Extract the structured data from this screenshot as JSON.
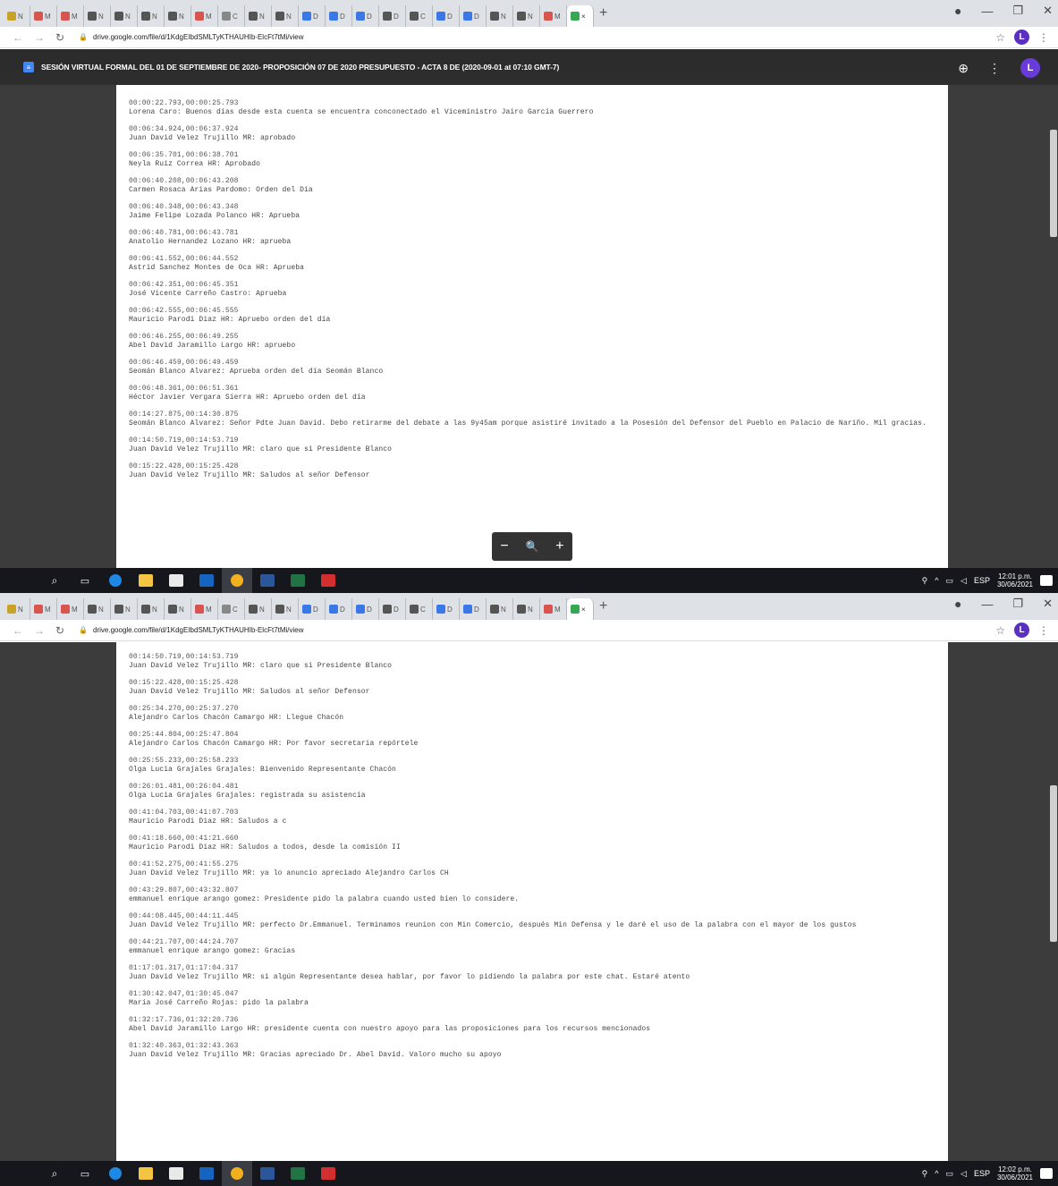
{
  "browser": {
    "url": "drive.google.com/file/d/1KdgEIbdSMLTyKTHAUHIb-ElcFt7tMi/view",
    "tabs": [
      {
        "label": "N",
        "fav": "#c9a227"
      },
      {
        "label": "M",
        "fav": "#d9534f"
      },
      {
        "label": "M",
        "fav": "#d9534f"
      },
      {
        "label": "N",
        "fav": "#555"
      },
      {
        "label": "N",
        "fav": "#555"
      },
      {
        "label": "N",
        "fav": "#555"
      },
      {
        "label": "N",
        "fav": "#555"
      },
      {
        "label": "M",
        "fav": "#d9534f"
      },
      {
        "label": "C",
        "fav": "#888"
      },
      {
        "label": "N",
        "fav": "#555"
      },
      {
        "label": "N",
        "fav": "#555"
      },
      {
        "label": "D",
        "fav": "#3b78e7"
      },
      {
        "label": "D",
        "fav": "#3b78e7"
      },
      {
        "label": "D",
        "fav": "#3b78e7"
      },
      {
        "label": "D",
        "fav": "#555"
      },
      {
        "label": "C",
        "fav": "#555"
      },
      {
        "label": "D",
        "fav": "#3b78e7"
      },
      {
        "label": "D",
        "fav": "#3b78e7"
      },
      {
        "label": "N",
        "fav": "#555"
      },
      {
        "label": "N",
        "fav": "#555"
      },
      {
        "label": "M",
        "fav": "#d9534f"
      },
      {
        "label": "×",
        "fav": "#34a853",
        "active": true
      }
    ]
  },
  "viewer": {
    "title": "SESIÓN VIRTUAL FORMAL DEL 01 DE SEPTIEMBRE DE 2020- PROPOSICIÓN 07 DE 2020 PRESUPUESTO - ACTA 8 DE (2020-09-01 at 07:10 GMT-7)",
    "avatar_letter": "L"
  },
  "transcript_top": [
    {
      "ts": "00:00:22.793,00:00:25.793",
      "txt": "Lorena Caro: Buenos días desde esta cuenta se encuentra conconectado el Viceministro Jairo García Guerrero"
    },
    {
      "ts": "00:06:34.924,00:06:37.924",
      "txt": "Juan David Velez Trujillo MR: aprobado"
    },
    {
      "ts": "00:06:35.701,00:06:38.701",
      "txt": "Neyla Ruiz Correa HR: Aprobado"
    },
    {
      "ts": "00:06:40.208,00:06:43.208",
      "txt": "Carmen Rosaca Arias Pardomo: Orden del Día"
    },
    {
      "ts": "00:06:40.348,00:06:43.348",
      "txt": "Jaime Felipe Lozada Polanco HR: Aprueba"
    },
    {
      "ts": "00:06:40.781,00:06:43.781",
      "txt": "Anatolio Hernandez Lozano HR: aprueba"
    },
    {
      "ts": "00:06:41.552,00:06:44.552",
      "txt": "Astrid Sanchez Montes de Oca HR: Aprueba"
    },
    {
      "ts": "00:06:42.351,00:06:45.351",
      "txt": "José Vicente Carreño Castro: Aprueba"
    },
    {
      "ts": "00:06:42.555,00:06:45.555",
      "txt": "Mauricio Parodi Diaz HR: Apruebo orden del día"
    },
    {
      "ts": "00:06:46.255,00:06:49.255",
      "txt": "Abel David Jaramillo Largo HR: apruebo"
    },
    {
      "ts": "00:06:46.459,00:06:49.459",
      "txt": "Seomán Blanco Alvarez: Aprueba orden del día Seomán Blanco"
    },
    {
      "ts": "00:06:48.361,00:06:51.361",
      "txt": "Héctor Javier Vergara Sierra HR: Apruebo orden del día"
    },
    {
      "ts": "00:14:27.875,00:14:30.875",
      "txt": "Seomán Blanco Alvarez: Señor Pdte Juan David. Debo retirarme del debate a las 9y45am porque asistiré invitado a la Posesión del Defensor del Pueblo en Palacio de Nariño. Mil gracias."
    },
    {
      "ts": "00:14:50.719,00:14:53.719",
      "txt": "Juan David Velez Trujillo MR: claro que si Presidente Blanco"
    },
    {
      "ts": "00:15:22.428,00:15:25.428",
      "txt": "Juan David Velez Trujillo MR: Saludos al señor Defensor"
    }
  ],
  "transcript_bottom": [
    {
      "ts": "00:14:50.719,00:14:53.719",
      "txt": "Juan David Velez Trujillo MR: claro que si Presidente Blanco"
    },
    {
      "ts": "00:15:22.428,00:15:25.428",
      "txt": "Juan David Velez Trujillo MR: Saludos al señor Defensor"
    },
    {
      "ts": "00:25:34.270,00:25:37.270",
      "txt": "Alejandro Carlos Chacón Camargo HR: Llegue Chacón"
    },
    {
      "ts": "00:25:44.804,00:25:47.804",
      "txt": "Alejandro Carlos Chacón Camargo HR: Por favor secretaria repórtele"
    },
    {
      "ts": "00:25:55.233,00:25:58.233",
      "txt": "Olga Lucia Grajales Grajales: Bienvenido Representante Chacón"
    },
    {
      "ts": "00:26:01.481,00:26:04.481",
      "txt": "Olga Lucia Grajales Grajales: registrada su asistencia"
    },
    {
      "ts": "00:41:04.703,00:41:07.703",
      "txt": "Mauricio Parodi Diaz HR: Saludos a c"
    },
    {
      "ts": "00:41:18.660,00:41:21.660",
      "txt": "Mauricio Parodi Diaz HR: Saludos a todos, desde la comisión II"
    },
    {
      "ts": "00:41:52.275,00:41:55.275",
      "txt": "Juan David Velez Trujillo MR: ya lo anuncio apreciado Alejandro Carlos CH"
    },
    {
      "ts": "00:43:29.807,00:43:32.807",
      "txt": "emmanuel enrique arango gomez: Presidente pido la palabra cuando usted bien lo considere."
    },
    {
      "ts": "00:44:08.445,00:44:11.445",
      "txt": "Juan David Velez Trujillo MR: perfecto Dr.Emmanuel. Terminamos reunion con Min Comercio, después Min Defensa y le daré el uso de la palabra con el mayor de los gustos"
    },
    {
      "ts": "00:44:21.707,00:44:24.707",
      "txt": "emmanuel enrique arango gomez: Gracias"
    },
    {
      "ts": "01:17:01.317,01:17:04.317",
      "txt": "Juan David Velez Trujillo MR: si algún Representante desea hablar, por favor lo pidiendo la palabra por este chat. Estaré atento"
    },
    {
      "ts": "01:30:42.047,01:30:45.047",
      "txt": "María José Carreño Rojas: pido la palabra"
    },
    {
      "ts": "01:32:17.736,01:32:20.736",
      "txt": "Abel David Jaramillo Largo HR: presidente cuenta con nuestro apoyo para las proposiciones para los recursos mencionados"
    },
    {
      "ts": "01:32:40.363,01:32:43.363",
      "txt": "Juan David Velez Trujillo MR: Gracias apreciado Dr. Abel David. Valoro mucho su apoyo"
    }
  ],
  "taskbar": {
    "time_top": "12:01 p.m.",
    "date_top": "30/06/2021",
    "time_bottom": "12:02 p.m.",
    "date_bottom": "30/06/2021",
    "lang": "ESP"
  }
}
